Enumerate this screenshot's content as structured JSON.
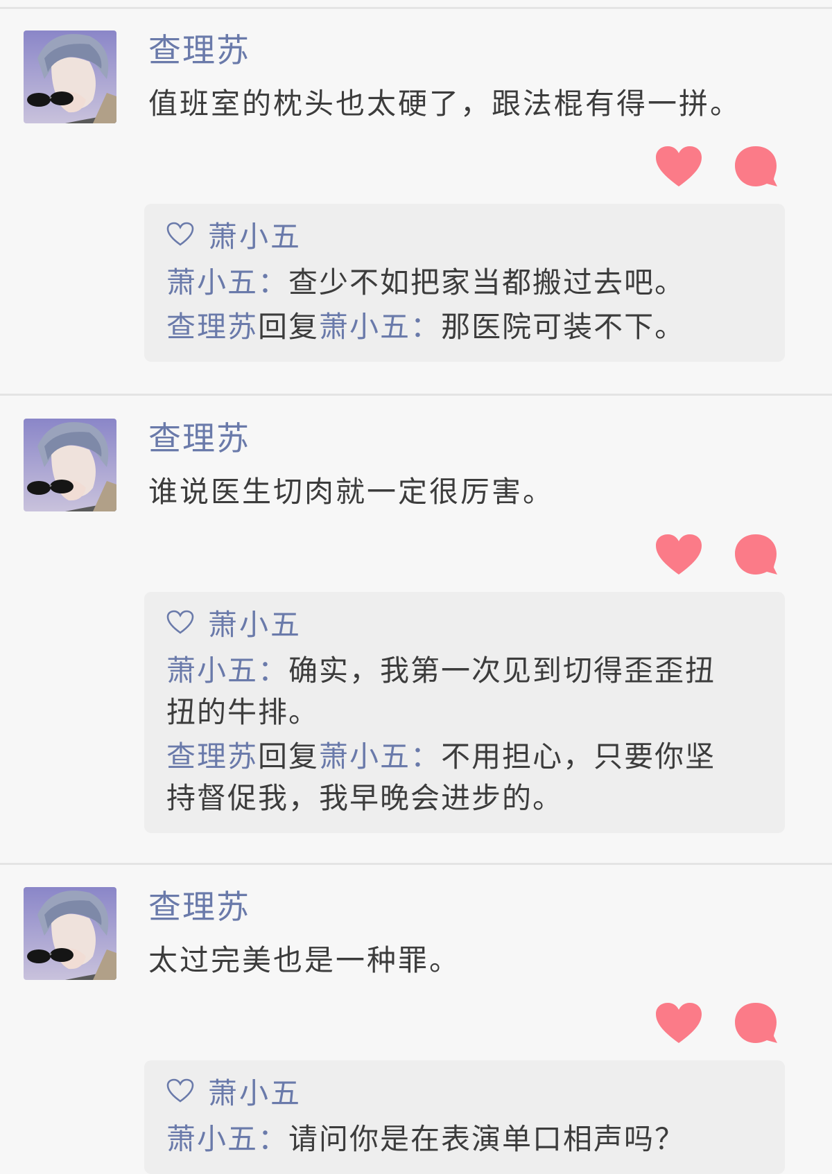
{
  "theme": {
    "name_color": "#6a7aaa",
    "text_color": "#3c3c3c",
    "accent_pink": "#fb7b88",
    "reply_bg": "#eeeeee"
  },
  "posts": [
    {
      "author": "查理苏",
      "text": "值班室的枕头也太硬了，跟法棍有得一拼。",
      "likes": [
        "萧小五"
      ],
      "comments": [
        {
          "from": "萧小五",
          "reply_word": "",
          "to": "",
          "colon": "：",
          "text": "查少不如把家当都搬过去吧。"
        },
        {
          "from": "查理苏",
          "reply_word": "回复",
          "to": "萧小五",
          "colon": "：",
          "text": "那医院可装不下。"
        }
      ]
    },
    {
      "author": "查理苏",
      "text": "谁说医生切肉就一定很厉害。",
      "likes": [
        "萧小五"
      ],
      "comments": [
        {
          "from": "萧小五",
          "reply_word": "",
          "to": "",
          "colon": "：",
          "text": "确实，我第一次见到切得歪歪扭",
          "text2": "扭的牛排。"
        },
        {
          "from": "查理苏",
          "reply_word": "回复",
          "to": "萧小五",
          "colon": "：",
          "text": "不用担心，只要你坚",
          "text2": "持督促我，我早晚会进步的。"
        }
      ]
    },
    {
      "author": "查理苏",
      "text": "太过完美也是一种罪。",
      "likes": [
        "萧小五"
      ],
      "comments": [
        {
          "from": "萧小五",
          "reply_word": "",
          "to": "",
          "colon": "：",
          "text": "请问你是在表演单口相声吗？"
        }
      ]
    }
  ]
}
